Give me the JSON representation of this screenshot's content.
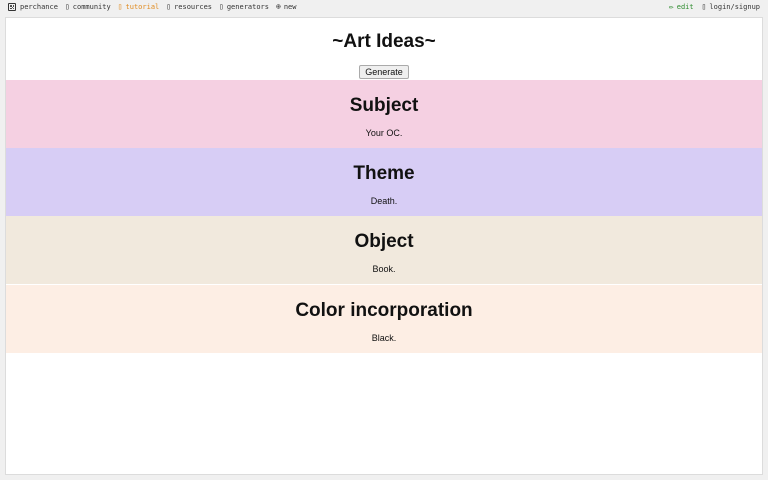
{
  "nav": {
    "brand": "perchance",
    "links": [
      {
        "label": "community",
        "icon": "chat-icon",
        "icon_glyph": "▯"
      },
      {
        "label": "tutorial",
        "icon": "book-icon",
        "icon_glyph": "▯"
      },
      {
        "label": "resources",
        "icon": "resources-icon",
        "icon_glyph": "▯"
      },
      {
        "label": "generators",
        "icon": "generators-icon",
        "icon_glyph": "▯"
      },
      {
        "label": "new",
        "icon": "plus-circle-icon",
        "icon_glyph": "⊕"
      }
    ],
    "edit": {
      "label": "edit",
      "icon_glyph": "✏"
    },
    "login": {
      "label": "login/signup",
      "icon_glyph": "▯"
    }
  },
  "page": {
    "title": "~Art Ideas~",
    "generate_label": "Generate"
  },
  "sections": [
    {
      "heading": "Subject",
      "value": "Your OC.",
      "color": "#f5d0e2"
    },
    {
      "heading": "Theme",
      "value": "Death.",
      "color": "#d7cdf5"
    },
    {
      "heading": "Object",
      "value": "Book.",
      "color": "#f1e9dd"
    },
    {
      "heading": "Color incorporation",
      "value": "Black.",
      "color": "#fdeee4"
    }
  ],
  "colors": {
    "tutorial": "#e08a1e",
    "edit": "#2e8b2e",
    "background": "#f0f0f0",
    "panel": "#ffffff"
  }
}
